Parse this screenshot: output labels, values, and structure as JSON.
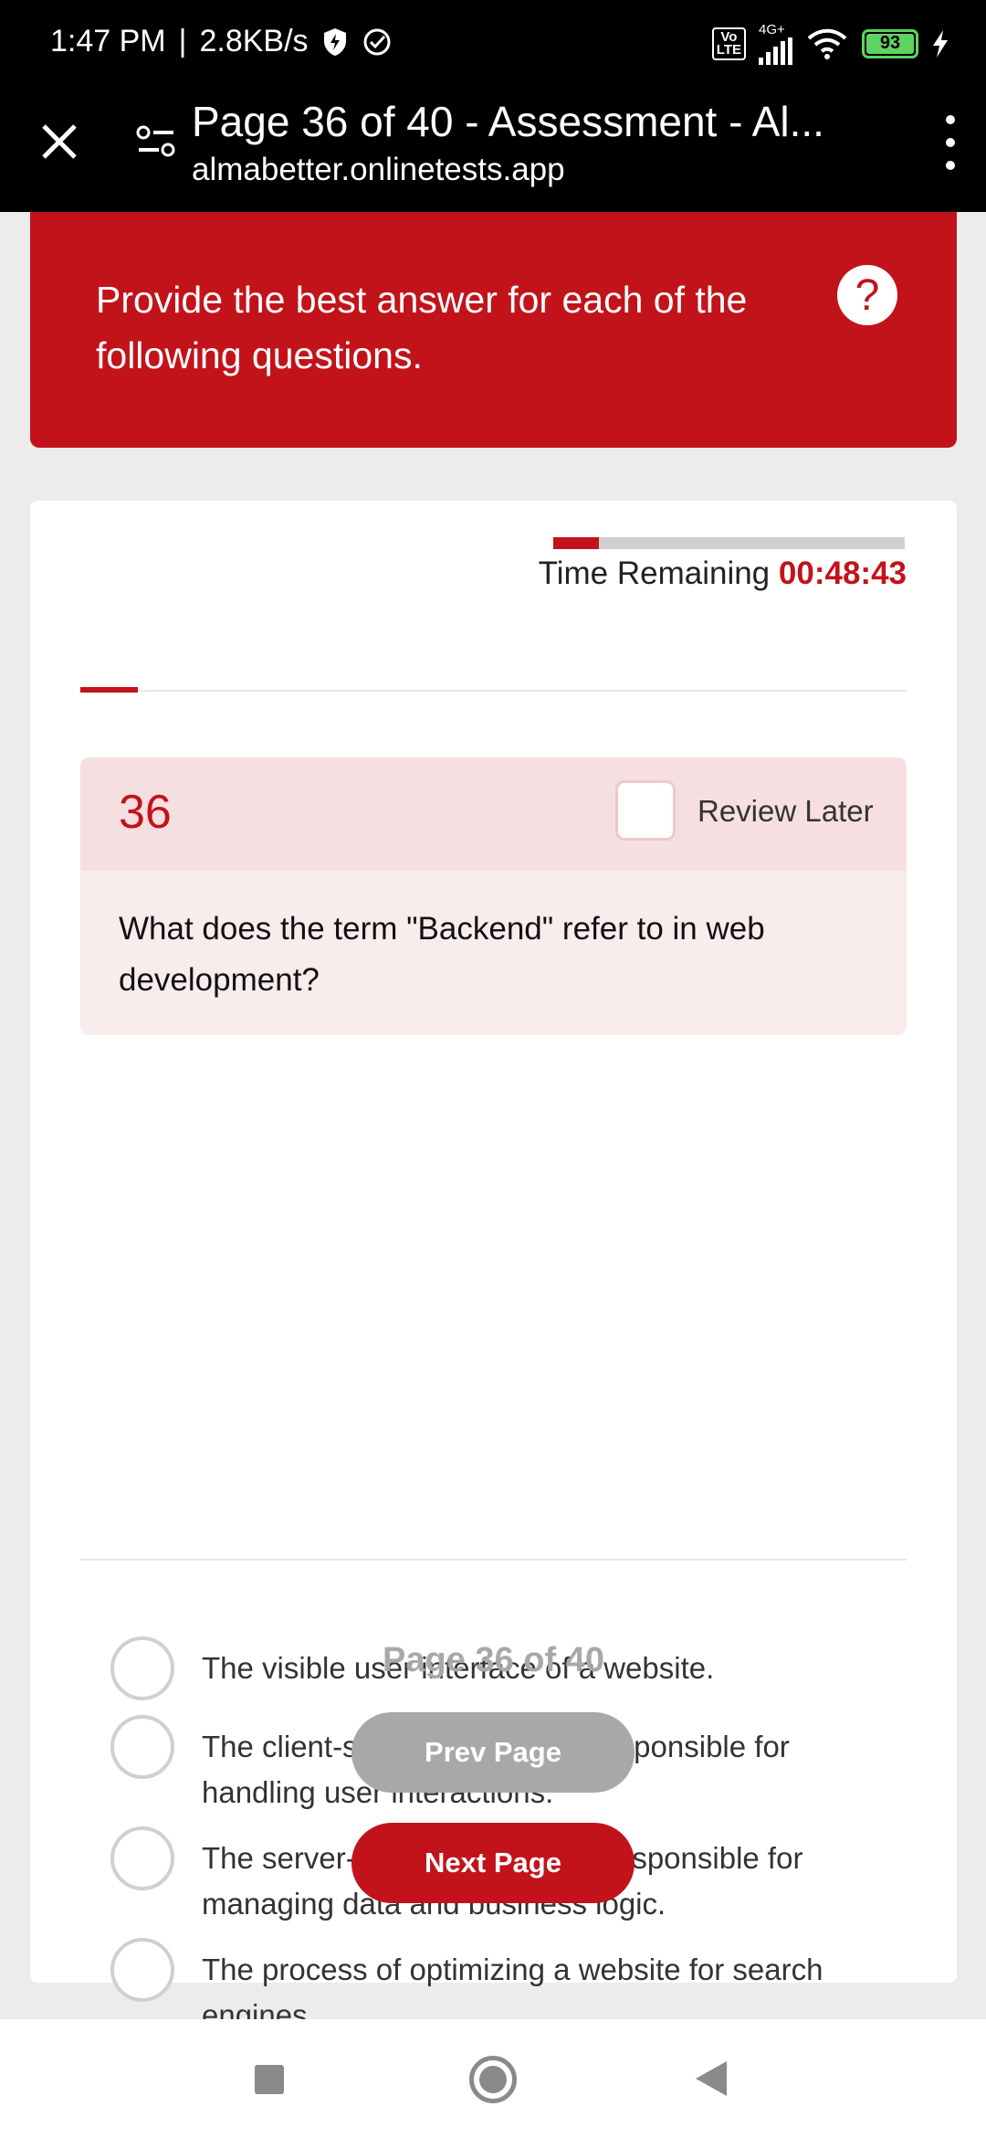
{
  "status_bar": {
    "time": "1:47 PM",
    "separator": "|",
    "net_speed": "2.8KB/s",
    "volte": "Vo\nLTE",
    "network": "4G+",
    "battery": "93"
  },
  "browser": {
    "title": "Page 36 of 40 - Assessment - Al...",
    "url": "almabetter.onlinetests.app"
  },
  "banner": {
    "instructions": "Provide the best answer for each of the following questions.",
    "help_symbol": "?"
  },
  "timer": {
    "label": "Time Remaining",
    "value": "00:48:43",
    "progress_fraction": 0.13
  },
  "assessment_progress_fraction": 0.07,
  "question": {
    "number": "36",
    "review_label": "Review Later",
    "review_checked": false,
    "text": "What does the term \"Backend\" refer to in web development?",
    "options": [
      "The visible user interface of a website.",
      "The client-side programming responsible for handling user interactions.",
      "The server-side programming responsible for managing data and business logic.",
      "The process of optimizing a website for search engines."
    ]
  },
  "pagination": {
    "label": "Page 36 of 40",
    "prev": "Prev Page",
    "next": "Next Page"
  },
  "colors": {
    "accent": "#c2131b",
    "muted": "#a8a8a8"
  },
  "icons": [
    "close-icon",
    "page-settings-icon",
    "more-vert-icon",
    "help-icon",
    "wifi-icon",
    "battery-icon",
    "charging-icon",
    "shield-icon",
    "check-circle-icon"
  ]
}
